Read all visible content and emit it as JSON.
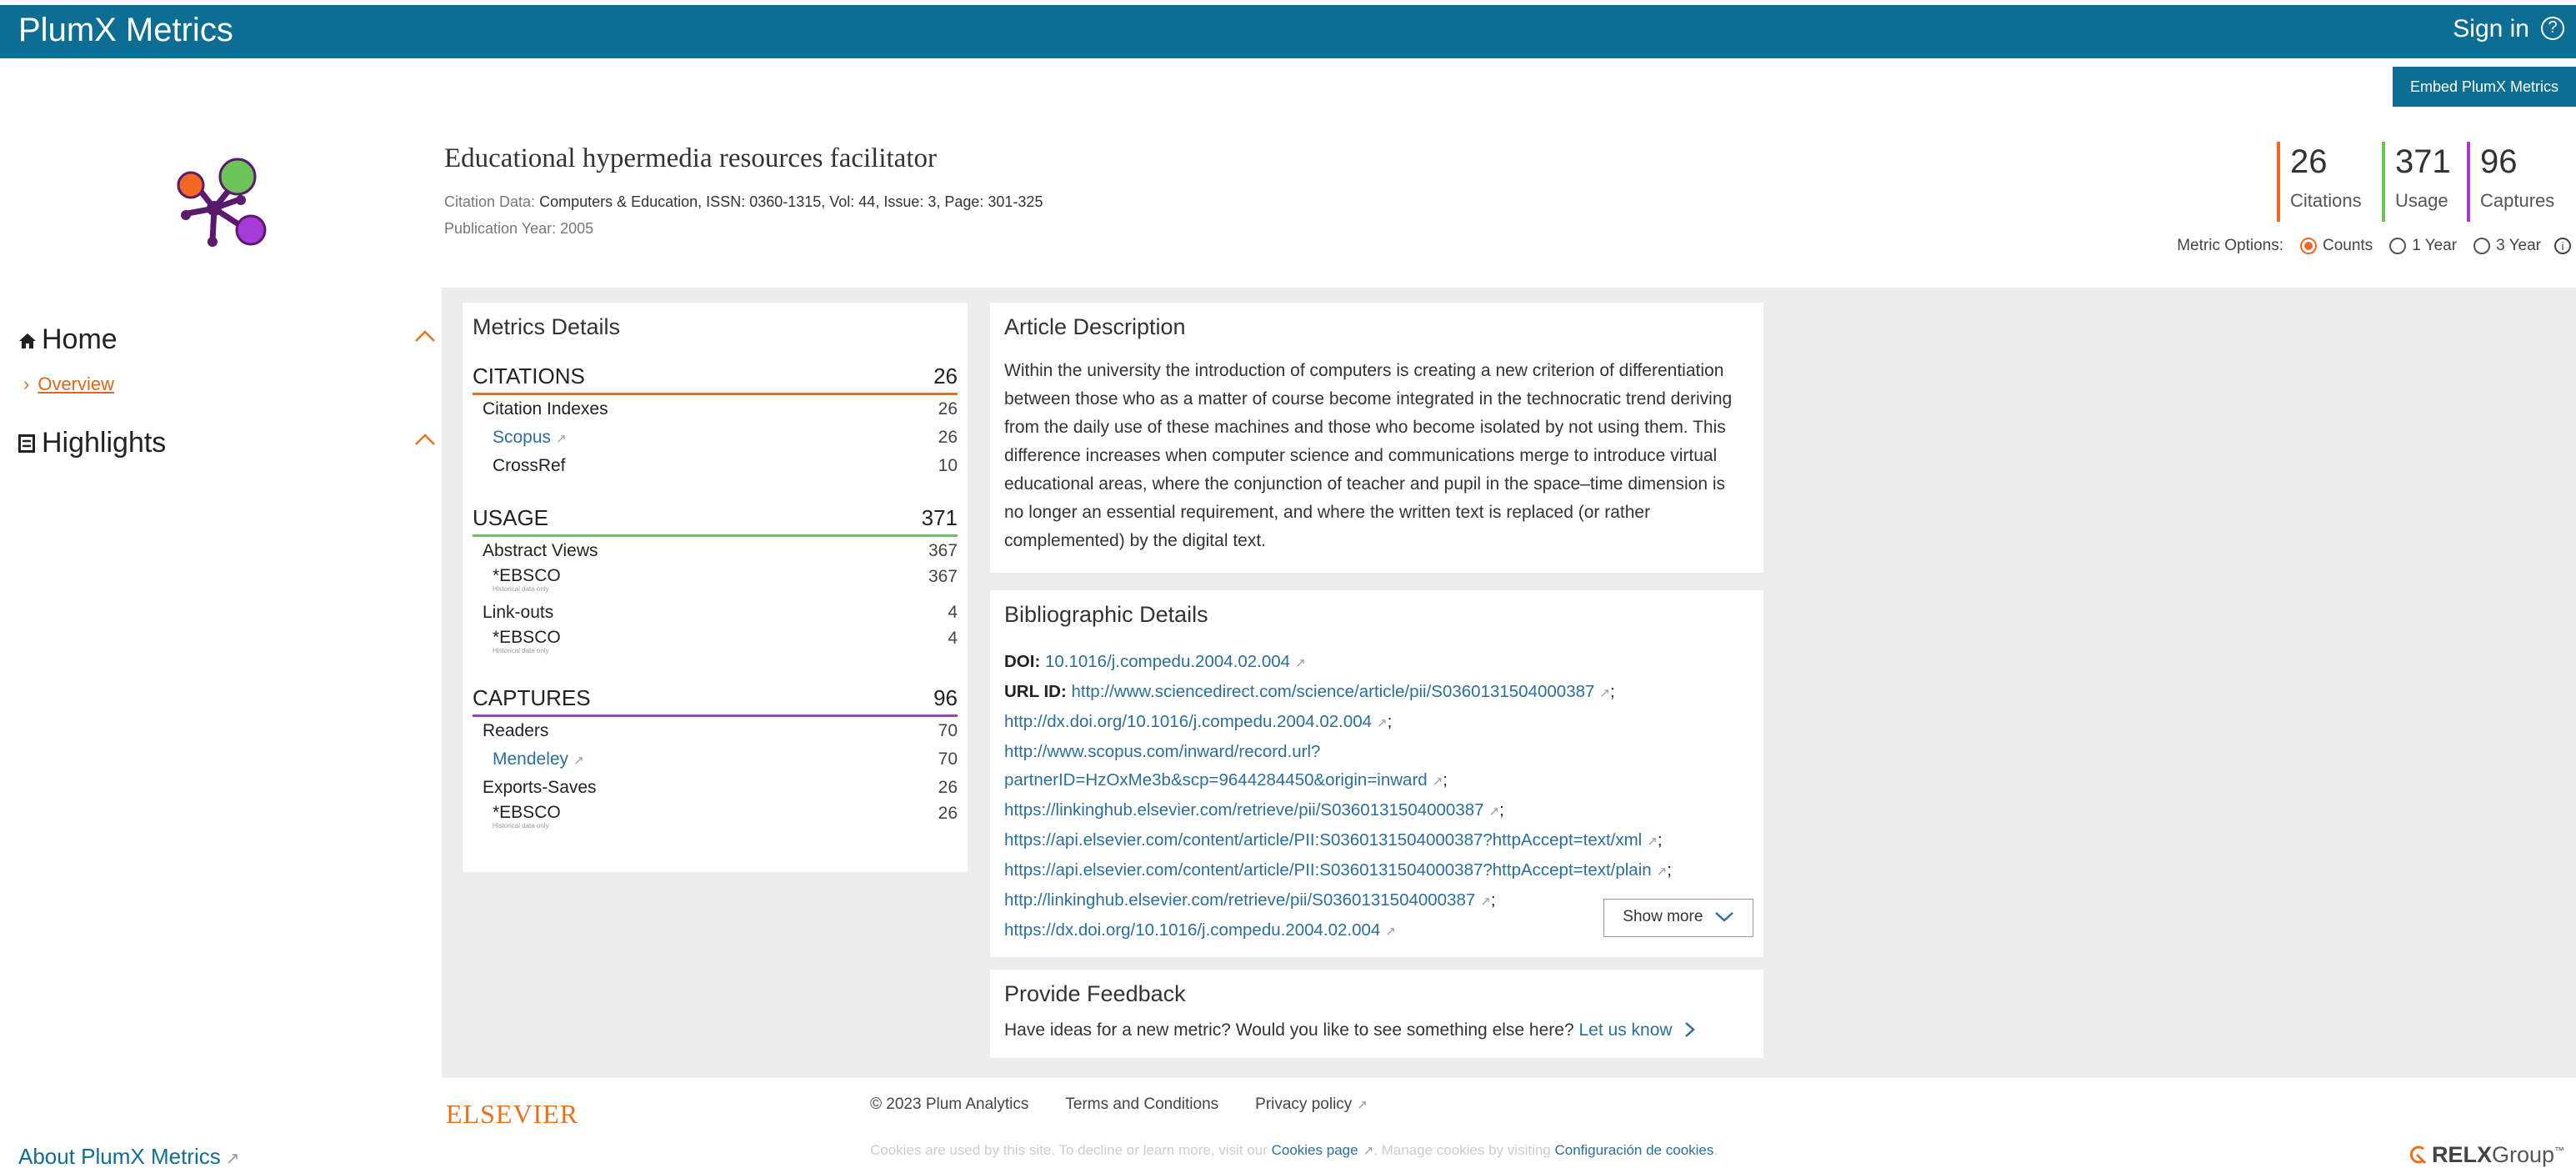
{
  "header": {
    "app_title": "PlumX Metrics",
    "sign_in": "Sign in",
    "help_glyph": "?"
  },
  "embed_button": "Embed PlumX Metrics",
  "article": {
    "title": "Educational hypermedia resources facilitator",
    "citation_label": "Citation Data:",
    "citation_value": "Computers & Education, ISSN: 0360-1315, Vol: 44, Issue: 3, Page: 301-325",
    "pub_label": "Publication Year:",
    "pub_value": "2005"
  },
  "summary": {
    "citations": {
      "value": "26",
      "label": "Citations",
      "color": "#f26722"
    },
    "usage": {
      "value": "371",
      "label": "Usage",
      "color": "#6dc559"
    },
    "captures": {
      "value": "96",
      "label": "Captures",
      "color": "#a63ad6"
    }
  },
  "metric_options": {
    "label": "Metric Options:",
    "counts": "Counts",
    "one_year": "1 Year",
    "three_year": "3 Year",
    "selected": "Counts"
  },
  "nav": {
    "home": "Home",
    "overview": "Overview",
    "highlights": "Highlights"
  },
  "metrics_details": {
    "title": "Metrics Details",
    "citations": {
      "label": "CITATIONS",
      "total": "26",
      "rows": [
        {
          "label": "Citation Indexes",
          "value": "26"
        },
        {
          "label": "Scopus",
          "value": "26"
        },
        {
          "label": "CrossRef",
          "value": "10"
        }
      ]
    },
    "usage": {
      "label": "USAGE",
      "total": "371",
      "rows": [
        {
          "label": "Abstract Views",
          "value": "367"
        },
        {
          "label": "*EBSCO",
          "value": "367",
          "note": "Historical data only"
        },
        {
          "label": "Link-outs",
          "value": "4"
        },
        {
          "label": "*EBSCO",
          "value": "4",
          "note": "Historical data only"
        }
      ]
    },
    "captures": {
      "label": "CAPTURES",
      "total": "96",
      "rows": [
        {
          "label": "Readers",
          "value": "70"
        },
        {
          "label": "Mendeley",
          "value": "70"
        },
        {
          "label": "Exports-Saves",
          "value": "26"
        },
        {
          "label": "*EBSCO",
          "value": "26",
          "note": "Historical data only"
        }
      ]
    }
  },
  "description": {
    "title": "Article Description",
    "text": "Within the university the introduction of computers is creating a new criterion of differentiation between those who as a matter of course become integrated in the technocratic trend deriving from the daily use of these machines and those who become isolated by not using them. This difference increases when computer science and communications merge to introduce virtual educational areas, where the conjunction of teacher and pupil in the space–time dimension is no longer an essential requirement, and where the written text is replaced (or rather complemented) by the digital text."
  },
  "biblio": {
    "title": "Bibliographic Details",
    "doi_label": "DOI:",
    "doi": "10.1016/j.compedu.2004.02.004",
    "url_label": "URL ID:",
    "urls": [
      "http://www.sciencedirect.com/science/article/pii/S0360131504000387",
      "http://dx.doi.org/10.1016/j.compedu.2004.02.004",
      "http://www.scopus.com/inward/record.url?",
      "partnerID=HzOxMe3b&scp=9644284450&origin=inward",
      "https://linkinghub.elsevier.com/retrieve/pii/S0360131504000387",
      "https://api.elsevier.com/content/article/PII:S0360131504000387?httpAccept=text/xml",
      "https://api.elsevier.com/content/article/PII:S0360131504000387?httpAccept=text/plain",
      "http://linkinghub.elsevier.com/retrieve/pii/S0360131504000387",
      "https://dx.doi.org/10.1016/j.compedu.2004.02.004"
    ],
    "separator": ";",
    "show_more": "Show more"
  },
  "feedback": {
    "title": "Provide Feedback",
    "text": "Have ideas for a new metric? Would you like to see something else here?",
    "link": "Let us know"
  },
  "footer": {
    "elsevier": "ELSEVIER",
    "copyright": "© 2023 Plum Analytics",
    "terms": "Terms and Conditions",
    "privacy": "Privacy policy",
    "cookie_text_1": "Cookies are used by this site. To decline or learn more, visit our",
    "cookie_link_1": "Cookies page",
    "cookie_text_2": ". Manage cookies by visiting",
    "cookie_link_2": "Configuración de cookies",
    "cookie_text_3": ".",
    "about": "About PlumX Metrics",
    "relx_bold": "RELX",
    "relx_rest": "Group",
    "tm": "™"
  }
}
